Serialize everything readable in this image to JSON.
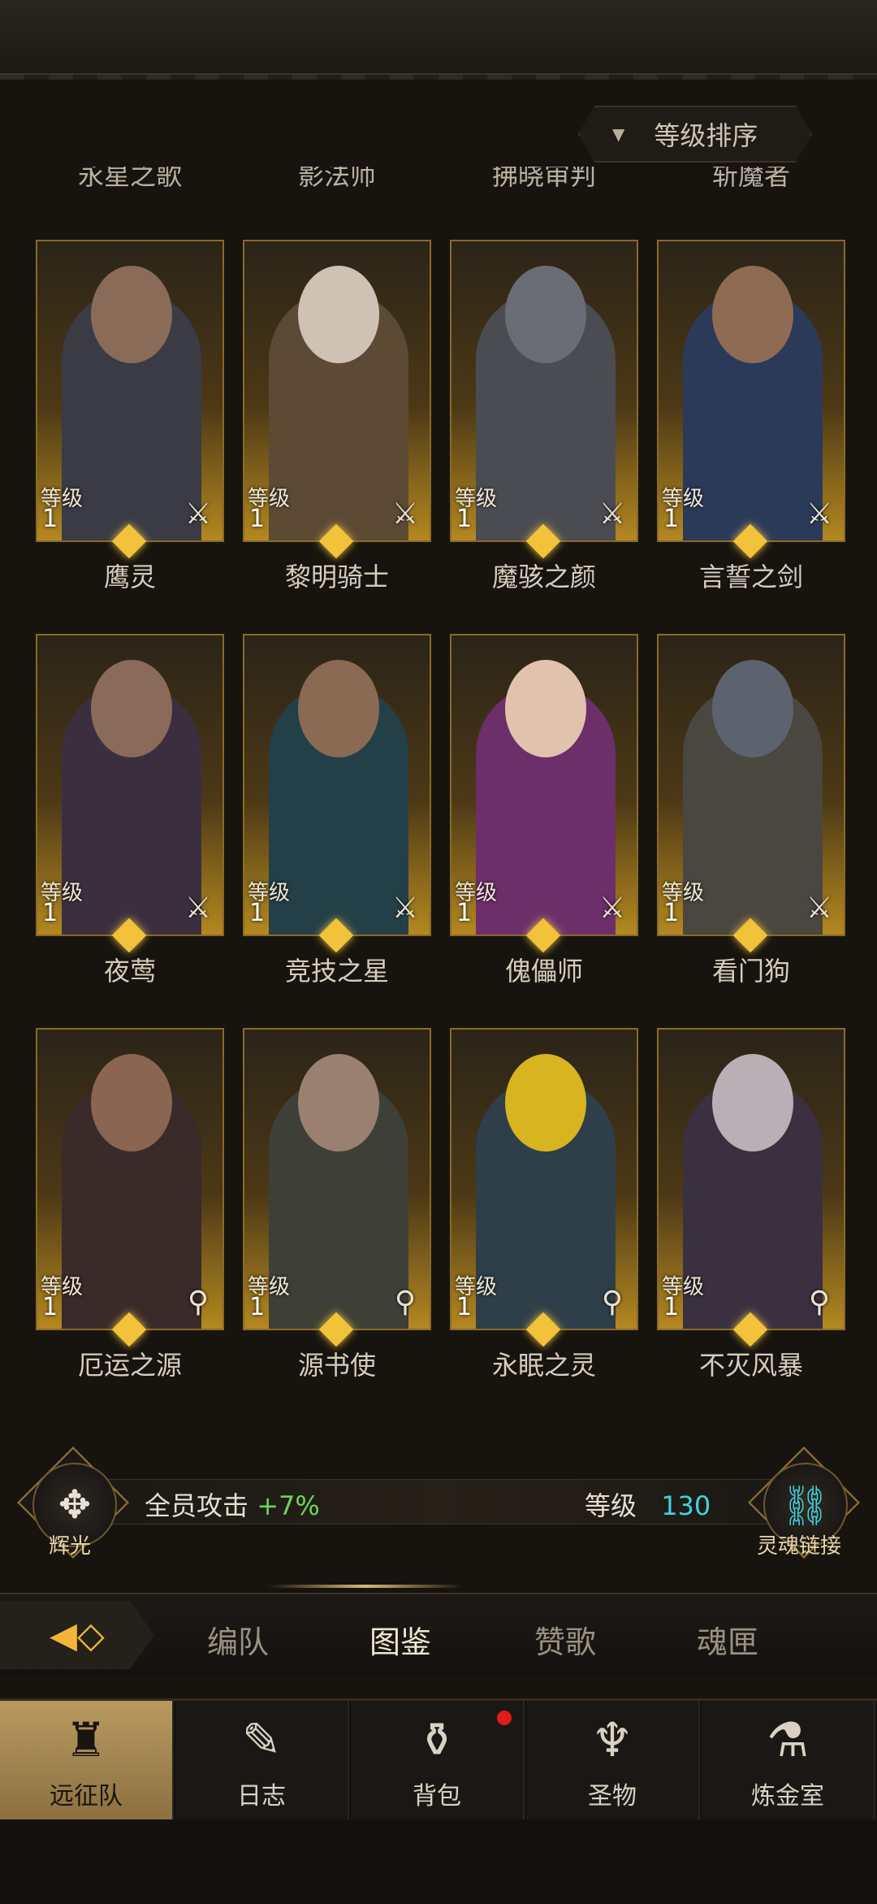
{
  "sort": {
    "label": "等级排序"
  },
  "previous_row_names": [
    "永星之歌",
    "影法师",
    "拂晓审判",
    "斩魔者"
  ],
  "heroes": [
    {
      "name": "鹰灵",
      "level_label": "等级",
      "level": "1",
      "class_icon": "sword-icon"
    },
    {
      "name": "黎明骑士",
      "level_label": "等级",
      "level": "1",
      "class_icon": "sword-icon"
    },
    {
      "name": "魔骇之颜",
      "level_label": "等级",
      "level": "1",
      "class_icon": "sword-icon"
    },
    {
      "name": "言誓之剑",
      "level_label": "等级",
      "level": "1",
      "class_icon": "sword-icon"
    },
    {
      "name": "夜莺",
      "level_label": "等级",
      "level": "1",
      "class_icon": "sword-icon"
    },
    {
      "name": "竞技之星",
      "level_label": "等级",
      "level": "1",
      "class_icon": "sword-icon"
    },
    {
      "name": "傀儡师",
      "level_label": "等级",
      "level": "1",
      "class_icon": "sword-icon"
    },
    {
      "name": "看门狗",
      "level_label": "等级",
      "level": "1",
      "class_icon": "sword-icon"
    },
    {
      "name": "厄运之源",
      "level_label": "等级",
      "level": "1",
      "class_icon": "staff-icon"
    },
    {
      "name": "源书使",
      "level_label": "等级",
      "level": "1",
      "class_icon": "staff-icon"
    },
    {
      "name": "永眠之灵",
      "level_label": "等级",
      "level": "1",
      "class_icon": "staff-icon"
    },
    {
      "name": "不灭风暴",
      "level_label": "等级",
      "level": "1",
      "class_icon": "staff-icon"
    }
  ],
  "stats": {
    "radiance_label": "辉光",
    "attack_label": "全员攻击",
    "attack_value": "+7%",
    "level_label": "等级",
    "level_value": "130",
    "soul_link_label": "灵魂链接"
  },
  "tabs": [
    "编队",
    "图鉴",
    "赞歌",
    "魂匣"
  ],
  "active_tab": "图鉴",
  "nav": [
    {
      "label": "远征队",
      "icon": "viking-helmet-icon",
      "active": true
    },
    {
      "label": "日志",
      "icon": "scroll-icon"
    },
    {
      "label": "背包",
      "icon": "bag-icon",
      "badge": true
    },
    {
      "label": "圣物",
      "icon": "chalice-icon"
    },
    {
      "label": "炼金室",
      "icon": "alchemy-icon"
    }
  ],
  "colors": {
    "gold": "#f2c23a",
    "green": "#6fd35a",
    "cyan": "#3fd3e0",
    "badge": "#e11a1a"
  }
}
